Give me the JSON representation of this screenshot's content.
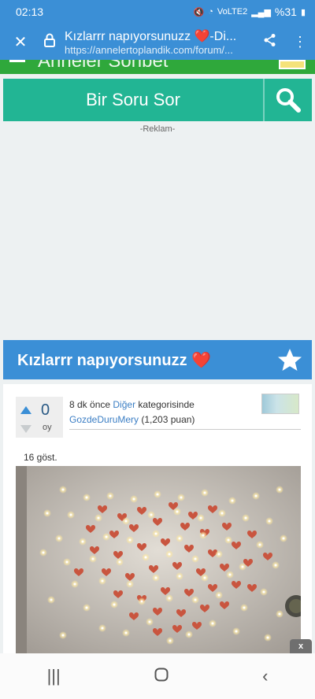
{
  "status_bar": {
    "time": "02:13",
    "network": "VoLTE2",
    "battery": "%31"
  },
  "browser": {
    "page_title": "Kızlarrr napıyorsunuzz ❤️-Di...",
    "url": "https://annelertoplandik.com/forum/...",
    "close_icon": "close-icon",
    "share_icon": "share-icon",
    "menu_icon": "more-vert-icon"
  },
  "site": {
    "brand": "Anneler Sohbet"
  },
  "ask": {
    "label": "Bir Soru Sor"
  },
  "ad": {
    "label": "-Reklam-",
    "close": "x"
  },
  "question": {
    "title": "Kızlarrr napıyorsunuzz ❤️",
    "votes": "0",
    "vote_unit": "oy",
    "time_ago": "8 dk önce",
    "category": "Diğer",
    "category_suffix": "kategorisinde",
    "user": "GozdeDuruMery",
    "points": "(1,203 puan)",
    "views": "16 göst."
  },
  "colors": {
    "primary": "#3b8fd6",
    "teal": "#22b594",
    "green": "#2fa83b"
  }
}
